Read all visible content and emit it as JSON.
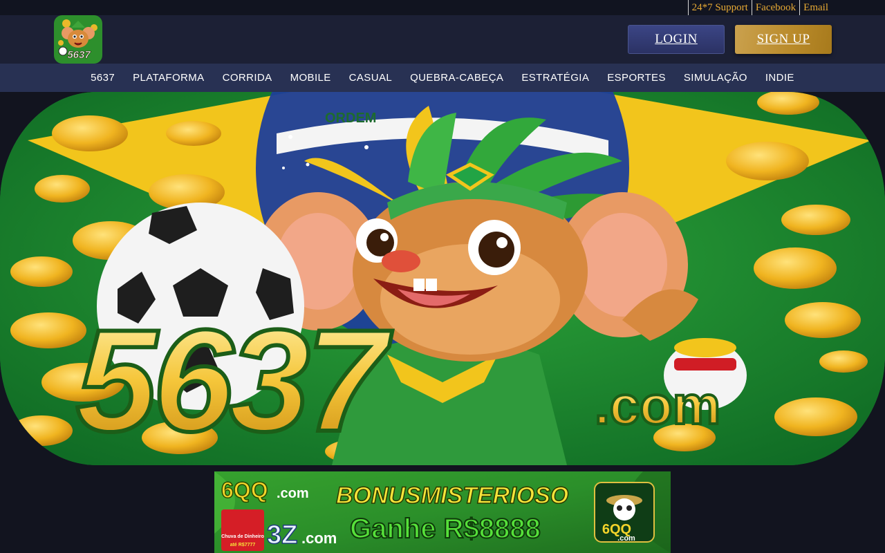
{
  "topbar": {
    "links": [
      "24*7 Support",
      "Facebook",
      "Email"
    ]
  },
  "header": {
    "logo_text": "5637",
    "login_label": "LOGIN",
    "signup_label": "SIGN UP"
  },
  "nav": {
    "items": [
      "5637",
      "PLATAFORMA",
      "CORRIDA",
      "MOBILE",
      "CASUAL",
      "QUEBRA-CABEÇA",
      "ESTRATÉGIA",
      "ESPORTES",
      "SIMULAÇÃO",
      "INDIE"
    ]
  },
  "hero": {
    "banner_text": "ORDEM",
    "brand": "5637",
    "brand_suffix": ".com"
  },
  "ad": {
    "brand_a": "6QQ",
    "brand_a_suffix": ".com",
    "headline": "BONUSMISTERIOSO",
    "offer": "Ganhe R$8888",
    "brand_b": "3Z",
    "brand_b_suffix": ".com",
    "badge_line1": "Chuva de Dinheiro",
    "badge_line2": "até R$7777",
    "panda_brand": "6QQ",
    "panda_suffix": ".com"
  },
  "colors": {
    "page_bg": "#12141f",
    "header_bg": "#1c2035",
    "nav_bg": "#283153",
    "topbar_link": "#e6a934",
    "login_bg": "#2f3870",
    "signup_bg": "#b98a2a"
  }
}
